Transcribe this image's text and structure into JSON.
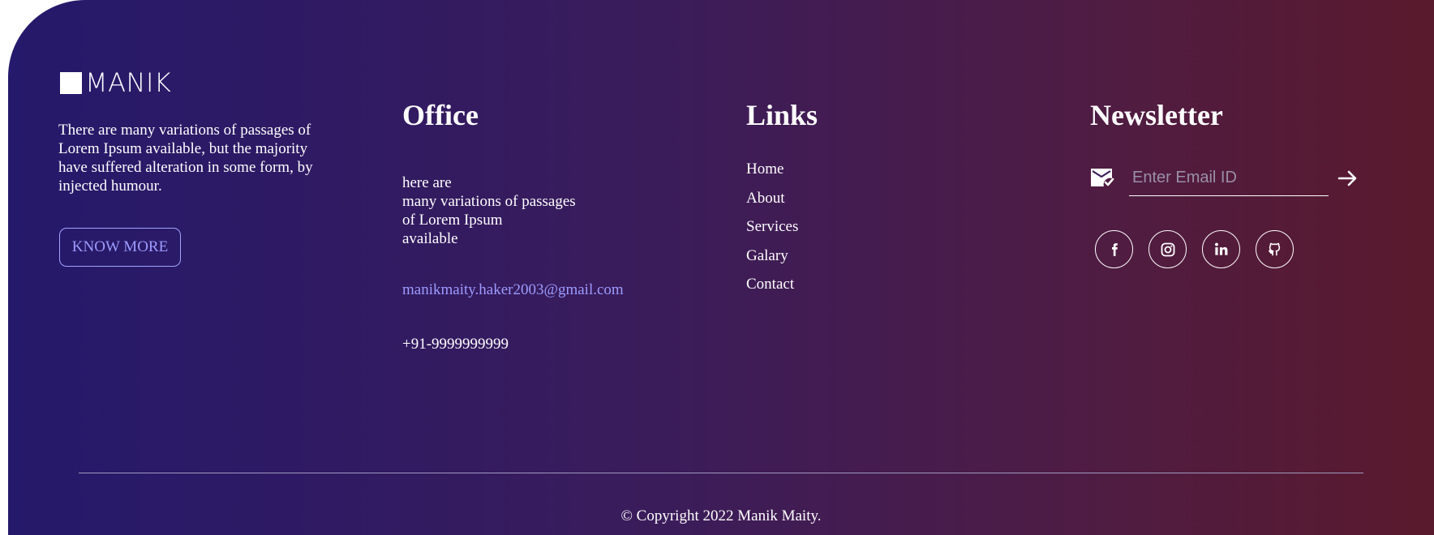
{
  "brand": {
    "name": "MANIK",
    "about": "There are many variations of passages of Lorem Ipsum available, but the majority have suffered alteration in some form, by injected humour.",
    "cta_label": "KNOW MORE"
  },
  "office": {
    "heading": "Office",
    "address_lines": [
      "here are",
      "many variations of passages",
      "of Lorem Ipsum",
      "available"
    ],
    "email": "manikmaity.haker2003@gmail.com",
    "phone": "+91-9999999999"
  },
  "links": {
    "heading": "Links",
    "items": [
      {
        "label": "Home"
      },
      {
        "label": "About"
      },
      {
        "label": "Services"
      },
      {
        "label": "Galary"
      },
      {
        "label": "Contact"
      }
    ]
  },
  "newsletter": {
    "heading": "Newsletter",
    "email_placeholder": "Enter Email ID",
    "email_value": "",
    "icons": {
      "mail": "mail-check-icon",
      "submit": "arrow-right-icon"
    }
  },
  "social": [
    {
      "icon": "facebook-icon"
    },
    {
      "icon": "instagram-icon"
    },
    {
      "icon": "linkedin-icon"
    },
    {
      "icon": "github-icon"
    }
  ],
  "copyright": "© Copyright 2022 Manik Maity.",
  "colors": {
    "gradient_start": "#25196b",
    "gradient_end": "#5a1a2d",
    "accent": "#9d9cff",
    "text": "#ffffff"
  }
}
